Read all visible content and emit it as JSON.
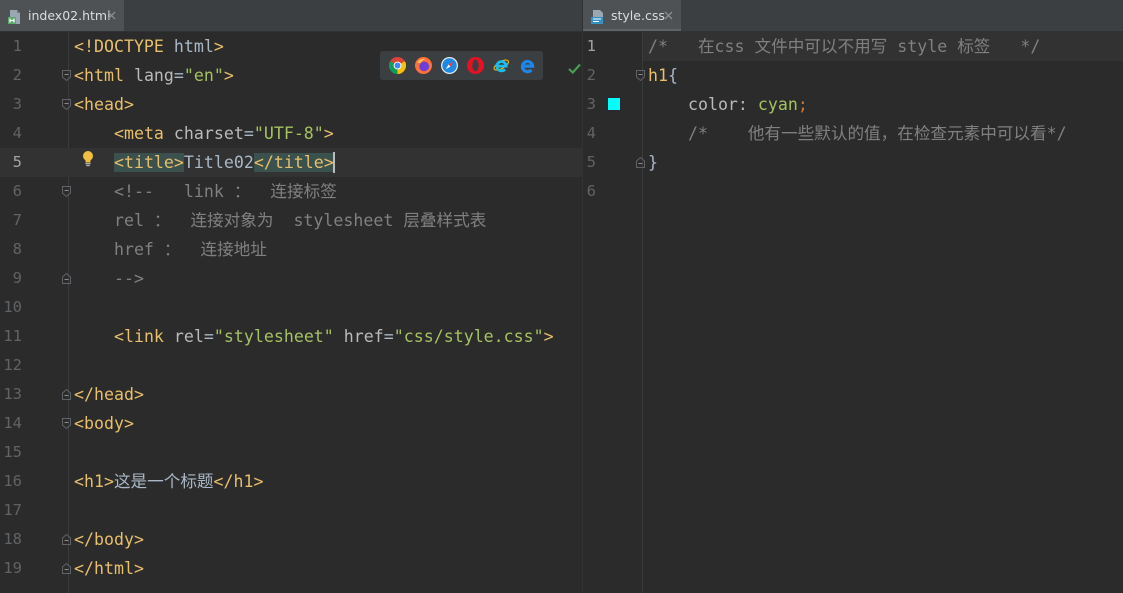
{
  "tabs": {
    "left": {
      "label": "index02.html",
      "icon": "html-file-icon"
    },
    "right": {
      "label": "style.css",
      "icon": "css-file-icon"
    }
  },
  "browser_icons": [
    "chrome-icon",
    "firefox-icon",
    "safari-icon",
    "opera-icon",
    "internet-explorer-icon",
    "edge-icon"
  ],
  "colors": {
    "tag": "#e8bf6a",
    "tagm": "#e8bf6a",
    "attr": "#bababa",
    "val": "#a5c261",
    "text": "#a9b7c6",
    "comment": "#808080",
    "sel": "#e8bf6a",
    "prop": "#bababa",
    "semi": "#cc7832",
    "swatch": "#00ffff",
    "check": "#499c54",
    "bulb": "#f0c040"
  },
  "left_editor": {
    "current_line": "5",
    "lines": [
      {
        "n": "1",
        "tokens": [
          {
            "c": "tag",
            "v": "<!DOCTYPE"
          },
          {
            "c": "text",
            "v": " html"
          },
          {
            "c": "tag",
            "v": ">"
          }
        ]
      },
      {
        "n": "2",
        "tokens": [
          {
            "c": "tag",
            "v": "<html"
          },
          {
            "c": "text",
            "v": " "
          },
          {
            "c": "attr",
            "v": "lang"
          },
          {
            "c": "text",
            "v": "="
          },
          {
            "c": "val",
            "v": "\"en\""
          },
          {
            "c": "tag",
            "v": ">"
          }
        ]
      },
      {
        "n": "3",
        "tokens": [
          {
            "c": "tag",
            "v": "<head>"
          }
        ]
      },
      {
        "n": "4",
        "tokens": [
          {
            "c": "text",
            "v": "    "
          },
          {
            "c": "tag",
            "v": "<meta"
          },
          {
            "c": "text",
            "v": " "
          },
          {
            "c": "attr",
            "v": "charset"
          },
          {
            "c": "text",
            "v": "="
          },
          {
            "c": "val",
            "v": "\"UTF-8\""
          },
          {
            "c": "tag",
            "v": ">"
          }
        ]
      },
      {
        "n": "5",
        "tokens": [
          {
            "c": "text",
            "v": "    "
          },
          {
            "c": "tagm",
            "v": "<title>"
          },
          {
            "c": "text",
            "v": "Title02"
          },
          {
            "c": "tagm",
            "v": "</title>"
          }
        ]
      },
      {
        "n": "6",
        "tokens": [
          {
            "c": "comment",
            "v": "    <!--   link ：  连接标签"
          }
        ]
      },
      {
        "n": "7",
        "tokens": [
          {
            "c": "comment",
            "v": "    rel ：  连接对象为  stylesheet 层叠样式表"
          }
        ]
      },
      {
        "n": "8",
        "tokens": [
          {
            "c": "comment",
            "v": "    href ：  连接地址"
          }
        ]
      },
      {
        "n": "9",
        "tokens": [
          {
            "c": "comment",
            "v": "    -->"
          }
        ]
      },
      {
        "n": "10",
        "tokens": []
      },
      {
        "n": "11",
        "tokens": [
          {
            "c": "text",
            "v": "    "
          },
          {
            "c": "tag",
            "v": "<link"
          },
          {
            "c": "text",
            "v": " "
          },
          {
            "c": "attr",
            "v": "rel"
          },
          {
            "c": "text",
            "v": "="
          },
          {
            "c": "val",
            "v": "\"stylesheet\""
          },
          {
            "c": "text",
            "v": " "
          },
          {
            "c": "attr",
            "v": "href"
          },
          {
            "c": "text",
            "v": "="
          },
          {
            "c": "val",
            "v": "\"css/style.css\""
          },
          {
            "c": "tag",
            "v": ">"
          }
        ]
      },
      {
        "n": "12",
        "tokens": []
      },
      {
        "n": "13",
        "tokens": [
          {
            "c": "tag",
            "v": "</head>"
          }
        ]
      },
      {
        "n": "14",
        "tokens": [
          {
            "c": "tag",
            "v": "<body>"
          }
        ]
      },
      {
        "n": "15",
        "tokens": []
      },
      {
        "n": "16",
        "tokens": [
          {
            "c": "tag",
            "v": "<h1>"
          },
          {
            "c": "text",
            "v": "这是一个标题"
          },
          {
            "c": "tag",
            "v": "</h1>"
          }
        ]
      },
      {
        "n": "17",
        "tokens": []
      },
      {
        "n": "18",
        "tokens": [
          {
            "c": "tag",
            "v": "</body>"
          }
        ]
      },
      {
        "n": "19",
        "tokens": [
          {
            "c": "tag",
            "v": "</html>"
          }
        ]
      }
    ]
  },
  "right_editor": {
    "current_line": "1",
    "lines": [
      {
        "n": "1",
        "tokens": [
          {
            "c": "comment",
            "v": "/*   在css 文件中可以不用写 style 标签   */"
          }
        ]
      },
      {
        "n": "2",
        "tokens": [
          {
            "c": "sel",
            "v": "h1"
          },
          {
            "c": "text",
            "v": "{"
          }
        ]
      },
      {
        "n": "3",
        "tokens": [
          {
            "c": "text",
            "v": "    "
          },
          {
            "c": "prop",
            "v": "color"
          },
          {
            "c": "text",
            "v": ": "
          },
          {
            "c": "val",
            "v": "cyan"
          },
          {
            "c": "semi",
            "v": ";"
          }
        ]
      },
      {
        "n": "4",
        "tokens": [
          {
            "c": "comment",
            "v": "    /*    他有一些默认的值，在检查元素中可以看*/"
          }
        ]
      },
      {
        "n": "5",
        "tokens": [
          {
            "c": "text",
            "v": "}"
          }
        ]
      },
      {
        "n": "6",
        "tokens": []
      }
    ]
  }
}
